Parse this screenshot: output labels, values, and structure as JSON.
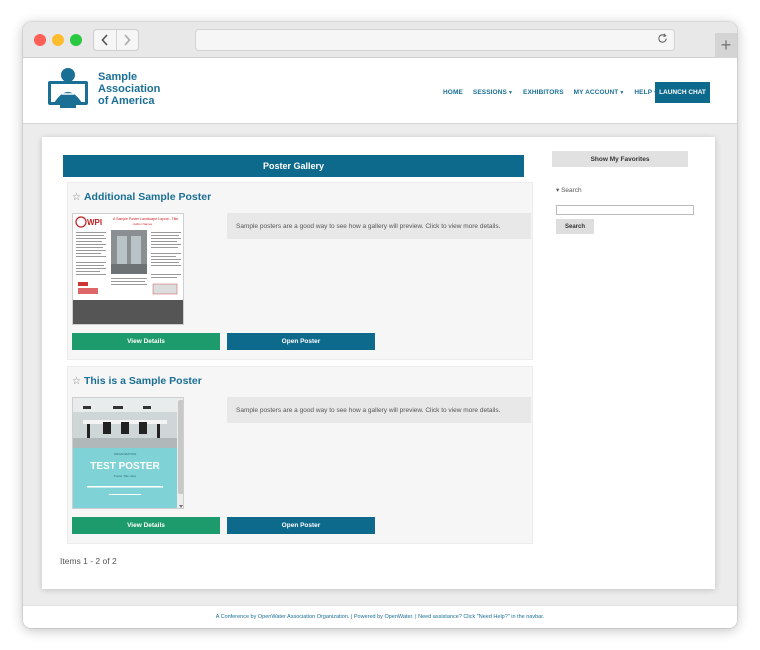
{
  "browser": {
    "back_icon": "chevron-left-icon",
    "forward_icon": "chevron-right-icon",
    "reload_icon": "reload-icon",
    "new_tab": "+"
  },
  "header": {
    "logo_lines": [
      "Sample",
      "Association",
      "of America"
    ],
    "nav": [
      {
        "label": "HOME",
        "dropdown": false
      },
      {
        "label": "SESSIONS",
        "dropdown": true
      },
      {
        "label": "EXHIBITORS",
        "dropdown": false
      },
      {
        "label": "MY ACCOUNT",
        "dropdown": true
      },
      {
        "label": "HELP",
        "dropdown": true
      }
    ],
    "launch_chat": "LAUNCH CHAT"
  },
  "gallery": {
    "title": "Poster Gallery",
    "posters": [
      {
        "title": "Additional Sample Poster",
        "description": "Sample posters are a good way to see how a gallery will preview. Click to view more details.",
        "view_details": "View Details",
        "open_poster": "Open Poster",
        "thumb": {
          "wpi": "WPI",
          "heading": "A Sample Poster Landscape Layout - Title",
          "sub": "Author Names"
        }
      },
      {
        "title": "This is a Sample Poster",
        "description": "Sample posters are a good way to see how a gallery will preview. Click to view more details.",
        "view_details": "View Details",
        "open_poster": "Open Poster",
        "thumb": {
          "org": "ORGANIZATION",
          "heading": "TEST POSTER",
          "sub": "Poster Title Here"
        }
      }
    ],
    "items_count": "Items 1 - 2 of 2"
  },
  "sidebar": {
    "favorites": "Show My Favorites",
    "search_toggle": "▾ Search",
    "search_value": "",
    "search_button": "Search"
  },
  "footer": {
    "text": "A Conference by OpenWater Association Organization. | Powered by OpenWater. | Need assistance? Click \"Need Help?\" in the navbar."
  },
  "colors": {
    "brand": "#0e6a8d",
    "brand_text": "#1a6f95",
    "green": "#1e9b6c"
  }
}
